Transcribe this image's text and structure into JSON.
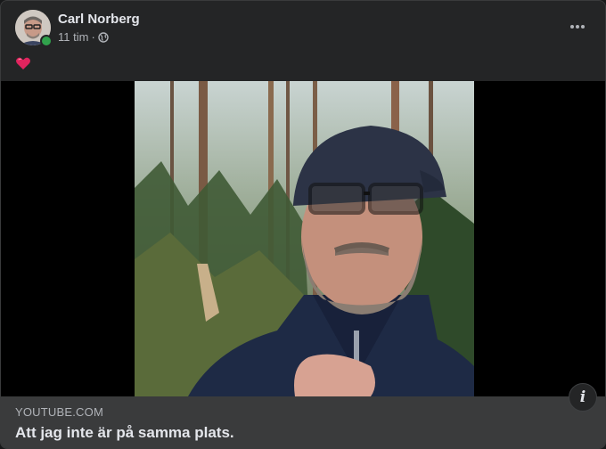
{
  "post": {
    "author": "Carl Norberg",
    "timestamp": "11 tim",
    "separator": "·",
    "privacy_icon": "globe-icon",
    "more_icon": "more-horizontal-icon",
    "message_icon": "red-heart-emoji"
  },
  "link_preview": {
    "domain": "YOUTUBE.COM",
    "title": "Att jag inte är på samma plats.",
    "info_icon": "info-icon"
  },
  "colors": {
    "card_background": "#242526",
    "link_background": "#3a3b3c",
    "primary_text": "#e4e6eb",
    "secondary_text": "#b0b3b8",
    "online_indicator": "#31a24c",
    "heart": "#e0245e"
  }
}
